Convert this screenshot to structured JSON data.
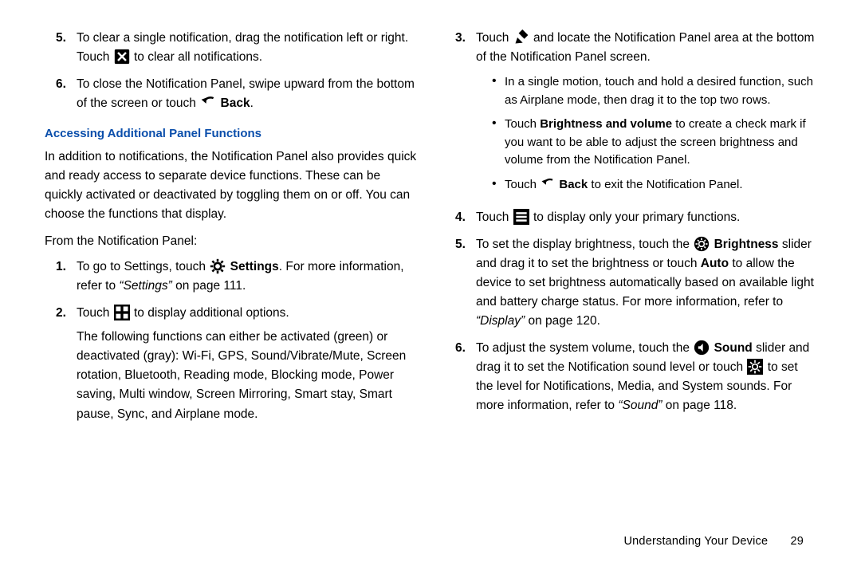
{
  "left": {
    "item5_a": "To clear a single notification, drag the notification left or right. Touch ",
    "item5_b": " to clear all notifications.",
    "item6_a": "To close the Notification Panel, swipe upward from the bottom of the screen or touch ",
    "item6_back": "Back",
    "item6_b": ".",
    "heading": "Accessing Additional Panel Functions",
    "intro": "In addition to notifications, the Notification Panel also provides quick and ready access to separate device functions. These can be quickly activated or deactivated by toggling them on or off. You can choose the functions that display.",
    "from": "From the Notification Panel:",
    "s1_a": "To go to Settings, touch ",
    "s1_settings": "Settings",
    "s1_b": ". For more information, refer to ",
    "s1_ref": "“Settings”",
    "s1_c": " on page 111.",
    "s2_a": "Touch ",
    "s2_b": " to display additional options.",
    "s2_body": "The following functions can either be activated (green) or deactivated (gray): Wi-Fi, GPS, Sound/Vibrate/Mute, Screen rotation, Bluetooth, Reading mode, Blocking mode, Power saving, Multi window, Screen Mirroring, Smart stay, Smart pause, Sync, and Airplane mode."
  },
  "right": {
    "s3_a": "Touch ",
    "s3_b": " and locate the Notification Panel area at the bottom of the Notification Panel screen.",
    "b1": "In a single motion, touch and hold a desired function, such as Airplane mode, then drag it to the top two rows.",
    "b2_a": "Touch ",
    "b2_bv": "Brightness and volume",
    "b2_b": " to create a check mark if you want to be able to adjust the screen brightness and volume from the Notification Panel.",
    "b3_a": "Touch ",
    "b3_back": "Back",
    "b3_b": " to exit the Notification Panel.",
    "s4_a": "Touch ",
    "s4_b": " to display only your primary functions.",
    "s5_a": "To set the display brightness, touch the ",
    "s5_br": "Brightness",
    "s5_b": " slider and drag it to set the brightness or touch ",
    "s5_auto": "Auto",
    "s5_c": " to allow the device to set brightness automatically based on available light and battery charge status. For more information, refer to ",
    "s5_ref": "“Display”",
    "s5_d": " on page 120.",
    "s6_a": "To adjust the system volume, touch the ",
    "s6_snd": "Sound",
    "s6_b": " slider and drag it to set the Notification sound level or touch ",
    "s6_c": " to set the level for Notifications, Media, and System sounds. For more information, refer to ",
    "s6_ref": "“Sound”",
    "s6_d": " on page 118."
  },
  "footer": {
    "chapter": "Understanding Your Device",
    "page": "29"
  },
  "nums": {
    "n1": "1.",
    "n2": "2.",
    "n3": "3.",
    "n4": "4.",
    "n5": "5.",
    "n6": "6."
  }
}
